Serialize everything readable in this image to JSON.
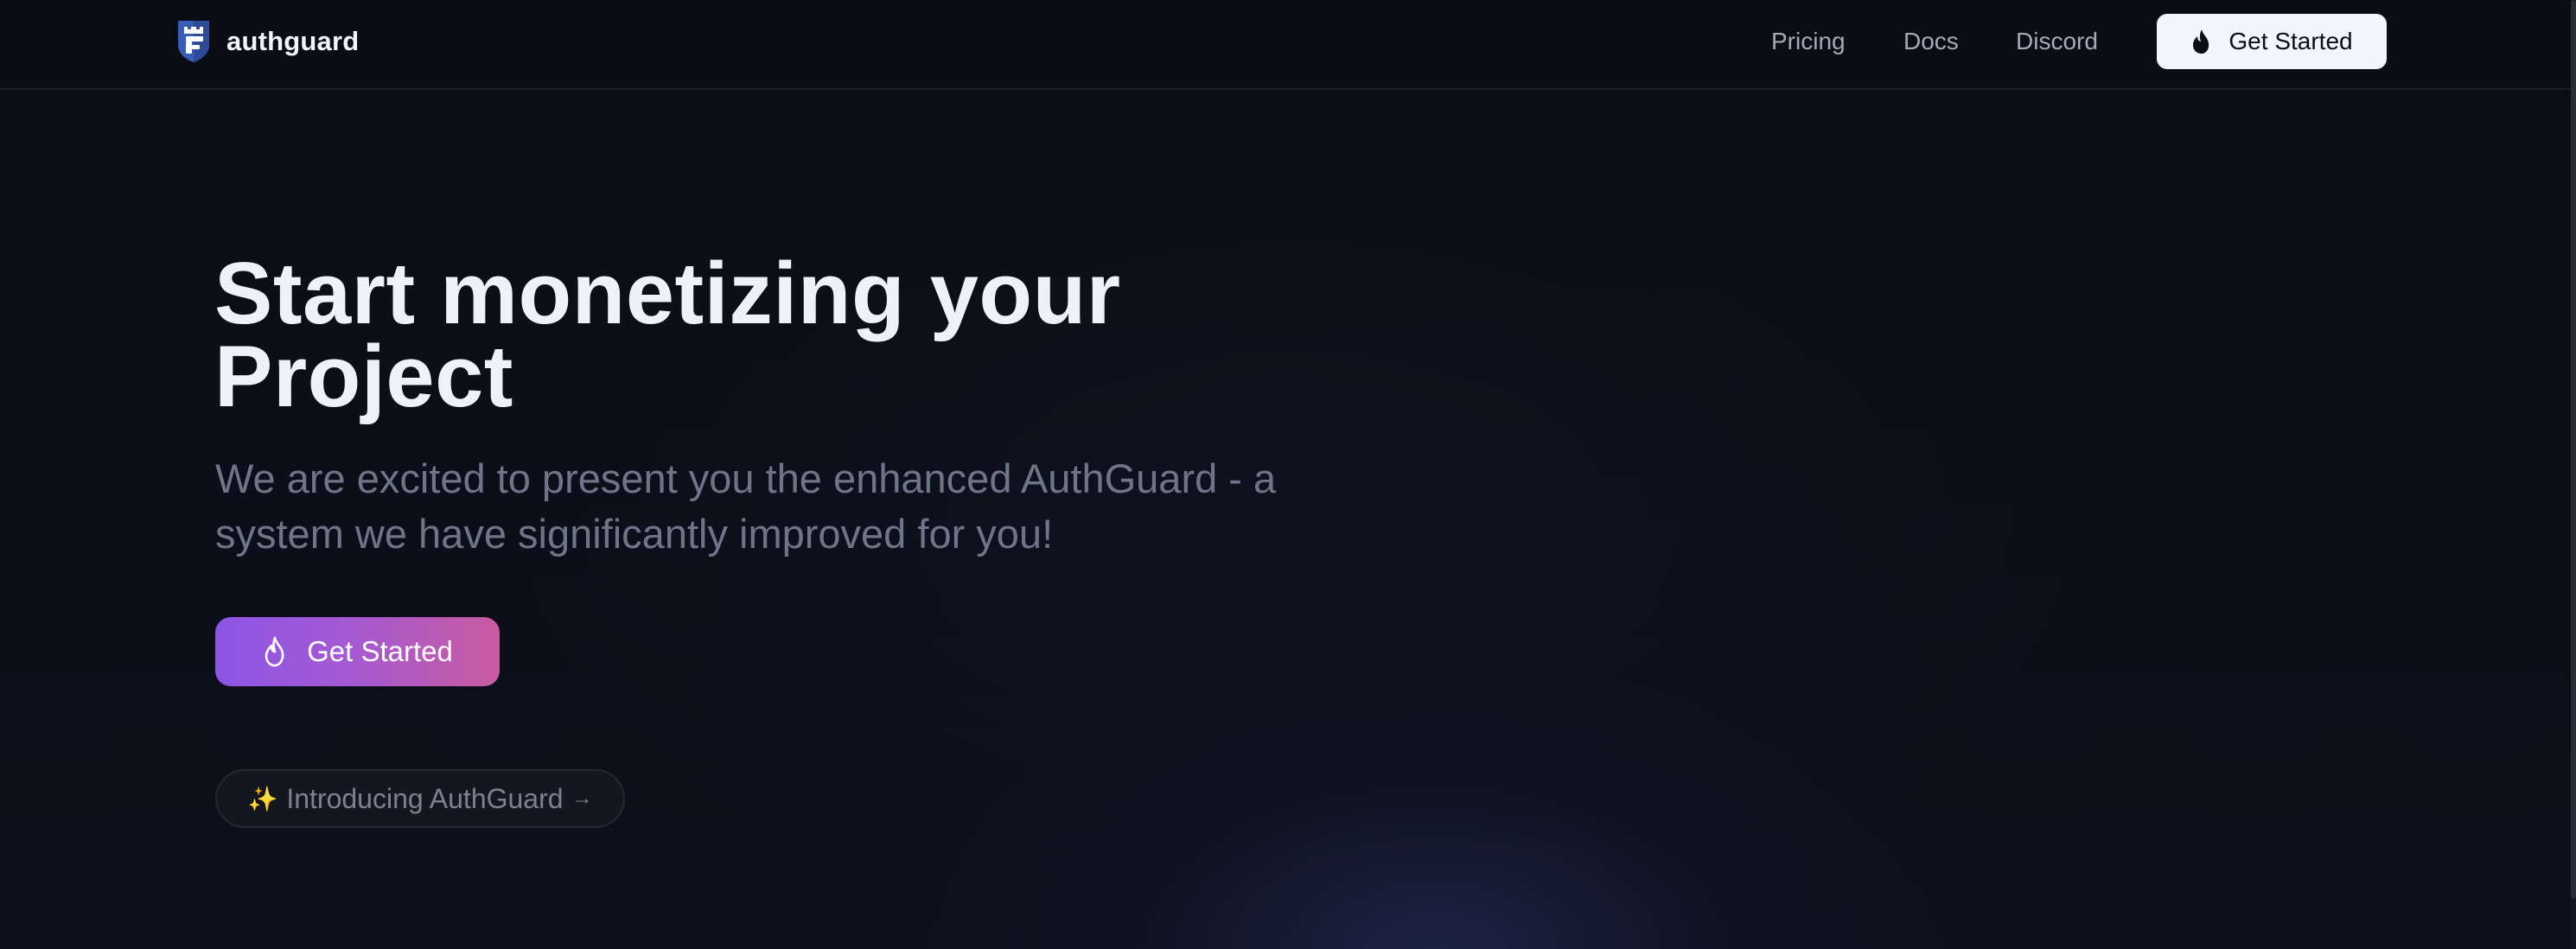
{
  "header": {
    "brand": "authguard",
    "nav": {
      "pricing": "Pricing",
      "docs": "Docs",
      "discord": "Discord"
    },
    "cta_label": "Get Started"
  },
  "hero": {
    "title_line1": "Start monetizing your",
    "title_line2": "Project",
    "subtitle": "We are excited to present you the enhanced AuthGuard - a system we have significantly improved for you!",
    "cta_label": "Get Started",
    "pill": {
      "sparkle": "✨",
      "label": "Introducing AuthGuard",
      "arrow": "→"
    }
  },
  "icons": {
    "logo": "shield-logo-icon",
    "header_cta": "flame-icon",
    "hero_cta": "flame-outline-icon"
  },
  "colors": {
    "background": "#0b0d16",
    "logo_blue": "#3a5bb7",
    "gradient_start": "#8c55e6",
    "gradient_end": "#c95ba0",
    "header_cta_bg": "#f3f5fa"
  }
}
